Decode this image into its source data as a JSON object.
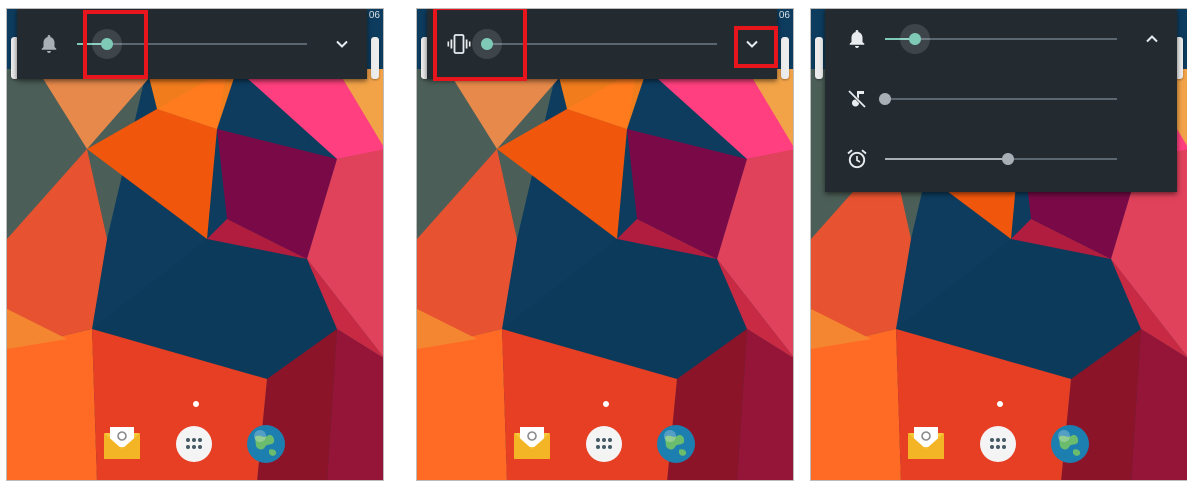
{
  "screens": [
    {
      "status_time": "06",
      "panel": {
        "rows": [
          {
            "icon": "bell-icon",
            "level": 0.13
          }
        ],
        "expand_icon": "chevron-down-icon"
      }
    },
    {
      "status_time": "06",
      "panel": {
        "rows": [
          {
            "icon": "vibrate-icon",
            "level": 0.0
          }
        ],
        "expand_icon": "chevron-down-icon"
      }
    },
    {
      "status_time": "",
      "panel": {
        "rows": [
          {
            "icon": "bell-icon",
            "level": 0.13
          },
          {
            "icon": "music-off-icon",
            "level": 0.0
          },
          {
            "icon": "alarm-icon",
            "level": 0.53
          }
        ],
        "expand_icon": "chevron-up-icon"
      }
    }
  ],
  "dock": [
    "email-app-icon",
    "app-drawer-icon",
    "browser-app-icon"
  ],
  "colors": {
    "panel_background": "#232b31",
    "accent_teal": "#7fc9b7",
    "inactive_gray": "#a9b0b5",
    "highlight_red": "#e8161c"
  }
}
